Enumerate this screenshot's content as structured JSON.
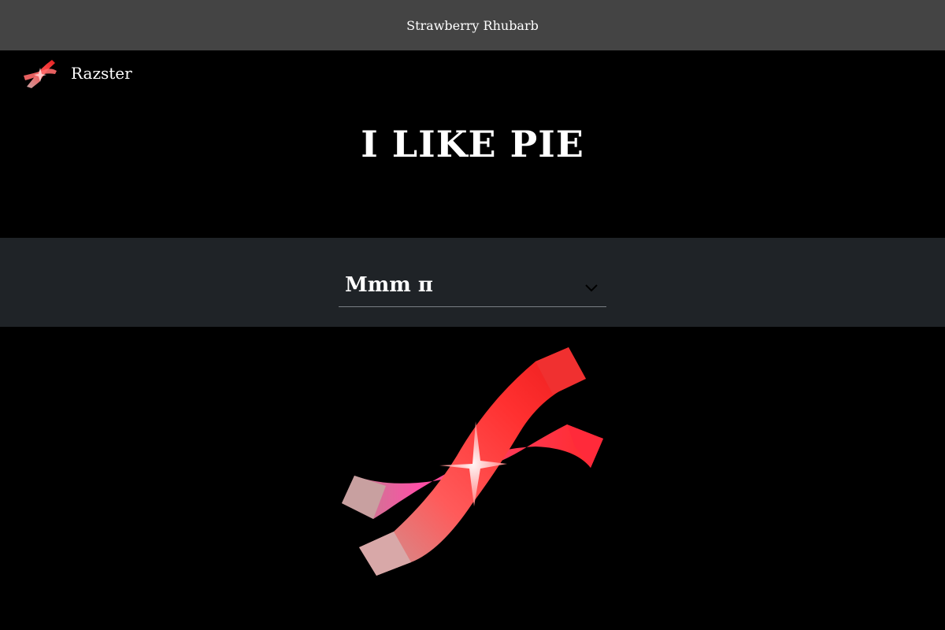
{
  "banner": {
    "text": "Strawberry Rhubarb"
  },
  "brand": {
    "name": "Razster",
    "logo_icon": "ribbon-x-logo-icon"
  },
  "headline": "I LIKE PIE",
  "selector": {
    "value": "Mmm π",
    "icon": "chevron-down-icon"
  },
  "hero": {
    "icon": "ribbon-x-hero-icon"
  },
  "colors": {
    "banner_bg": "#444444",
    "page_bg": "#000000",
    "selector_bg": "#1f2327",
    "accent_red": "#ff3b3b",
    "accent_pink": "#ff5fa8"
  }
}
